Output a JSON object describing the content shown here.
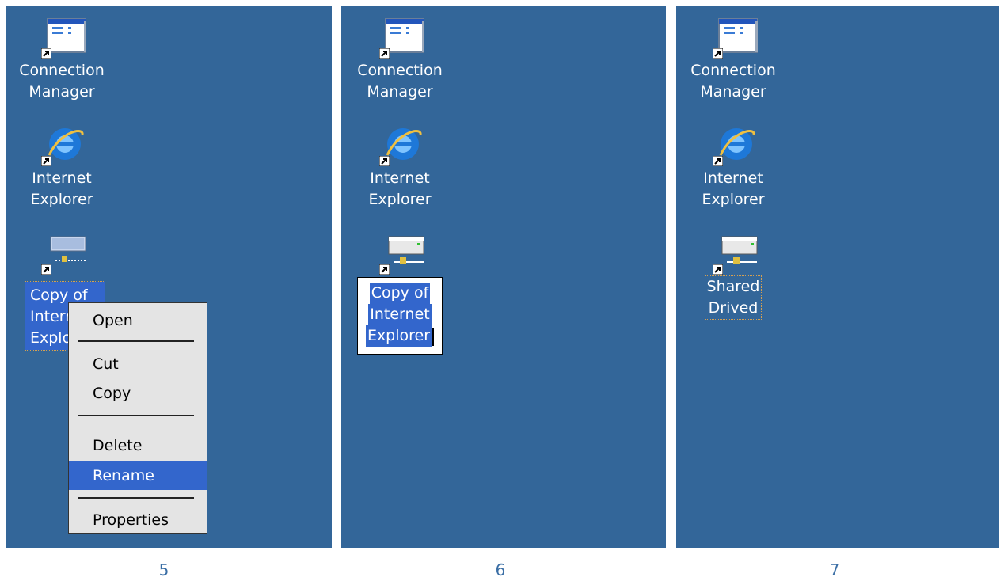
{
  "panels": [
    {
      "step_label": "5",
      "icons": [
        {
          "name": "Connection\nManager"
        },
        {
          "name": "Internet\nExplorer"
        },
        {
          "name": "Copy of\nInternet\nExplorer",
          "visible_text": [
            "Copy of",
            "Intern",
            "Explor"
          ]
        }
      ],
      "context_menu": {
        "items": [
          "Open",
          "Cut",
          "Copy",
          "Delete",
          "Rename",
          "Properties"
        ],
        "highlighted": "Rename"
      }
    },
    {
      "step_label": "6",
      "icons": [
        {
          "name": "Connection\nManager"
        },
        {
          "name": "Internet\nExplorer"
        }
      ],
      "rename_box": {
        "lines": [
          "Copy of",
          "Internet",
          "Explorer"
        ]
      }
    },
    {
      "step_label": "7",
      "icons": [
        {
          "name": "Connection\nManager"
        },
        {
          "name": "Internet\nExplorer"
        },
        {
          "name": "Shared\nDrived"
        }
      ]
    }
  ],
  "colors": {
    "desktop": "#336699",
    "selection": "#3366cc",
    "menu_bg": "#e4e4e4",
    "step_label": "#3a6ea5"
  },
  "icon_names": [
    "connection-manager-icon",
    "internet-explorer-icon",
    "network-drive-icon",
    "shortcut-arrow-icon"
  ]
}
